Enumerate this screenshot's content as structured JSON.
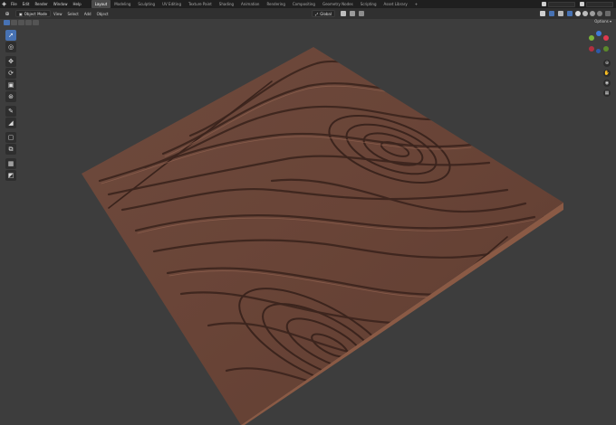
{
  "topbar": {
    "logo_icon": "blender-logo-icon",
    "menus": [
      "File",
      "Edit",
      "Render",
      "Window",
      "Help"
    ],
    "workspaces": [
      "Layout",
      "Modeling",
      "Sculpting",
      "UV Editing",
      "Texture Paint",
      "Shading",
      "Animation",
      "Rendering",
      "Compositing",
      "Geometry Nodes",
      "Scripting",
      "Asset Library"
    ],
    "active_workspace": "Layout",
    "add_workspace_label": "+"
  },
  "viewport_header": {
    "editor_type_icon": "3d-viewport-icon",
    "mode": "Object Mode",
    "menus": [
      "View",
      "Select",
      "Add",
      "Object"
    ],
    "orientation": "Global",
    "options_label": "Options"
  },
  "toolbar": {
    "tools": [
      "select-box-icon",
      "cursor-icon",
      "move-icon",
      "rotate-icon",
      "scale-icon",
      "transform-icon",
      "annotate-icon",
      "measure-icon",
      "add-cube-icon",
      "extrude-icon",
      "shear-icon",
      "brush-icon"
    ]
  },
  "gizmo": {
    "colors": {
      "x": "#e0394f",
      "y": "#7ab33a",
      "z": "#3f79d9"
    }
  },
  "colors": {
    "viewport_bg": "#3d3d3d",
    "wood": "#6b473a",
    "wood_dark": "#3e2620",
    "accent": "#4772b3"
  }
}
